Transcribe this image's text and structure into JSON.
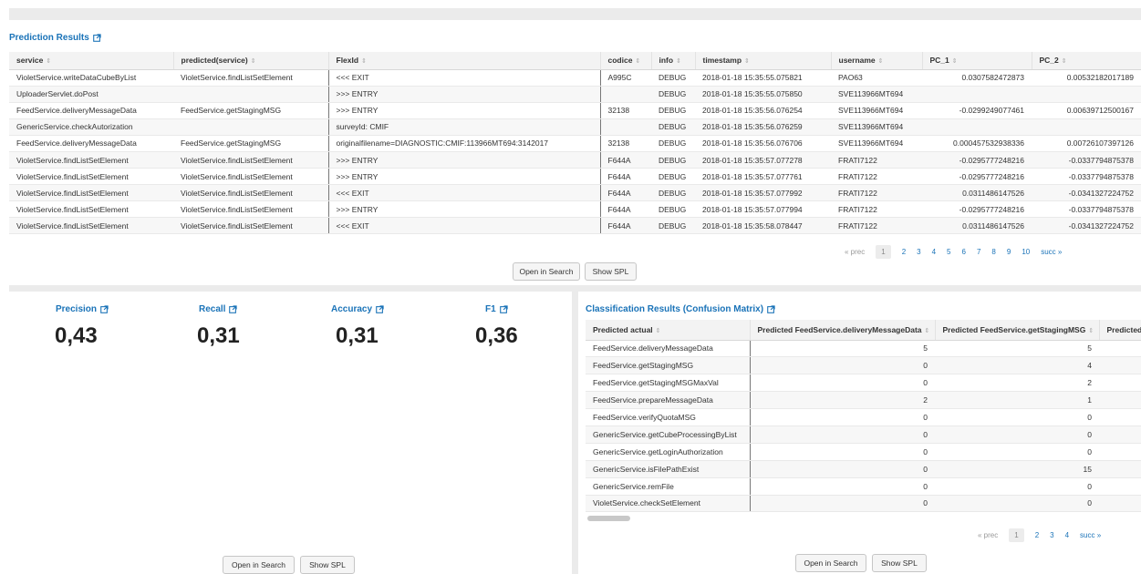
{
  "prediction": {
    "title": "Prediction Results",
    "columns": [
      "service",
      "predicted(service)",
      "FlexId",
      "codice",
      "info",
      "timestamp",
      "username",
      "PC_1",
      "PC_2"
    ],
    "rows": [
      [
        "VioletService.writeDataCubeByList",
        "VioletService.findListSetElement",
        "<<< EXIT",
        "A995C",
        "DEBUG",
        "2018-01-18 15:35:55.075821",
        "PAO63",
        "0.0307582472873",
        "0.00532182017189"
      ],
      [
        "UploaderServlet.doPost",
        "",
        ">>> ENTRY",
        "",
        "DEBUG",
        "2018-01-18 15:35:55.075850",
        "SVE113966MT694",
        "",
        ""
      ],
      [
        "FeedService.deliveryMessageData",
        "FeedService.getStagingMSG",
        ">>> ENTRY",
        "32138",
        "DEBUG",
        "2018-01-18 15:35:56.076254",
        "SVE113966MT694",
        "-0.0299249077461",
        "0.00639712500167"
      ],
      [
        "GenericService.checkAutorization",
        "",
        "surveyId: CMIF",
        "",
        "DEBUG",
        "2018-01-18 15:35:56.076259",
        "SVE113966MT694",
        "",
        ""
      ],
      [
        "FeedService.deliveryMessageData",
        "FeedService.getStagingMSG",
        "originalfilename=DIAGNOSTIC:CMIF:113966MT694:3142017",
        "32138",
        "DEBUG",
        "2018-01-18 15:35:56.076706",
        "SVE113966MT694",
        "0.000457532938336",
        "0.00726107397126"
      ],
      [
        "VioletService.findListSetElement",
        "VioletService.findListSetElement",
        ">>> ENTRY",
        "F644A",
        "DEBUG",
        "2018-01-18 15:35:57.077278",
        "FRATI7122",
        "-0.0295777248216",
        "-0.0337794875378"
      ],
      [
        "VioletService.findListSetElement",
        "VioletService.findListSetElement",
        ">>> ENTRY",
        "F644A",
        "DEBUG",
        "2018-01-18 15:35:57.077761",
        "FRATI7122",
        "-0.0295777248216",
        "-0.0337794875378"
      ],
      [
        "VioletService.findListSetElement",
        "VioletService.findListSetElement",
        "<<< EXIT",
        "F644A",
        "DEBUG",
        "2018-01-18 15:35:57.077992",
        "FRATI7122",
        "0.0311486147526",
        "-0.0341327224752"
      ],
      [
        "VioletService.findListSetElement",
        "VioletService.findListSetElement",
        ">>> ENTRY",
        "F644A",
        "DEBUG",
        "2018-01-18 15:35:57.077994",
        "FRATI7122",
        "-0.0295777248216",
        "-0.0337794875378"
      ],
      [
        "VioletService.findListSetElement",
        "VioletService.findListSetElement",
        "<<< EXIT",
        "F644A",
        "DEBUG",
        "2018-01-18 15:35:58.078447",
        "FRATI7122",
        "0.0311486147526",
        "-0.0341327224752"
      ]
    ],
    "pager": {
      "prev": "« prec",
      "pages": [
        "1",
        "2",
        "3",
        "4",
        "5",
        "6",
        "7",
        "8",
        "9",
        "10"
      ],
      "current": "1",
      "next": "succ »"
    },
    "open_in_search": "Open in Search",
    "show_spl": "Show SPL"
  },
  "metrics": {
    "precision": {
      "label": "Precision",
      "value": "0,43"
    },
    "recall": {
      "label": "Recall",
      "value": "0,31"
    },
    "accuracy": {
      "label": "Accuracy",
      "value": "0,31"
    },
    "f1": {
      "label": "F1",
      "value": "0,36"
    },
    "open_in_search": "Open in Search",
    "show_spl": "Show SPL"
  },
  "confusion": {
    "title": "Classification Results (Confusion Matrix)",
    "columns": [
      "Predicted actual",
      "Predicted FeedService.deliveryMessageData",
      "Predicted FeedService.getStagingMSG",
      "Predicted"
    ],
    "rows": [
      [
        "FeedService.deliveryMessageData",
        "5",
        "5",
        ""
      ],
      [
        "FeedService.getStagingMSG",
        "0",
        "4",
        ""
      ],
      [
        "FeedService.getStagingMSGMaxVal",
        "0",
        "2",
        ""
      ],
      [
        "FeedService.prepareMessageData",
        "2",
        "1",
        ""
      ],
      [
        "FeedService.verifyQuotaMSG",
        "0",
        "0",
        ""
      ],
      [
        "GenericService.getCubeProcessingByList",
        "0",
        "0",
        ""
      ],
      [
        "GenericService.getLoginAuthorization",
        "0",
        "0",
        ""
      ],
      [
        "GenericService.isFilePathExist",
        "0",
        "15",
        ""
      ],
      [
        "GenericService.remFile",
        "0",
        "0",
        ""
      ],
      [
        "VioletService.checkSetElement",
        "0",
        "0",
        ""
      ]
    ],
    "pager": {
      "prev": "« prec",
      "pages": [
        "1",
        "2",
        "3",
        "4"
      ],
      "current": "1",
      "next": "succ »"
    },
    "open_in_search": "Open in Search",
    "show_spl": "Show SPL"
  },
  "colors": {
    "accent": "#1a73b8",
    "header_bg": "#f3f3f3",
    "panel_gap": "#ebebeb"
  }
}
